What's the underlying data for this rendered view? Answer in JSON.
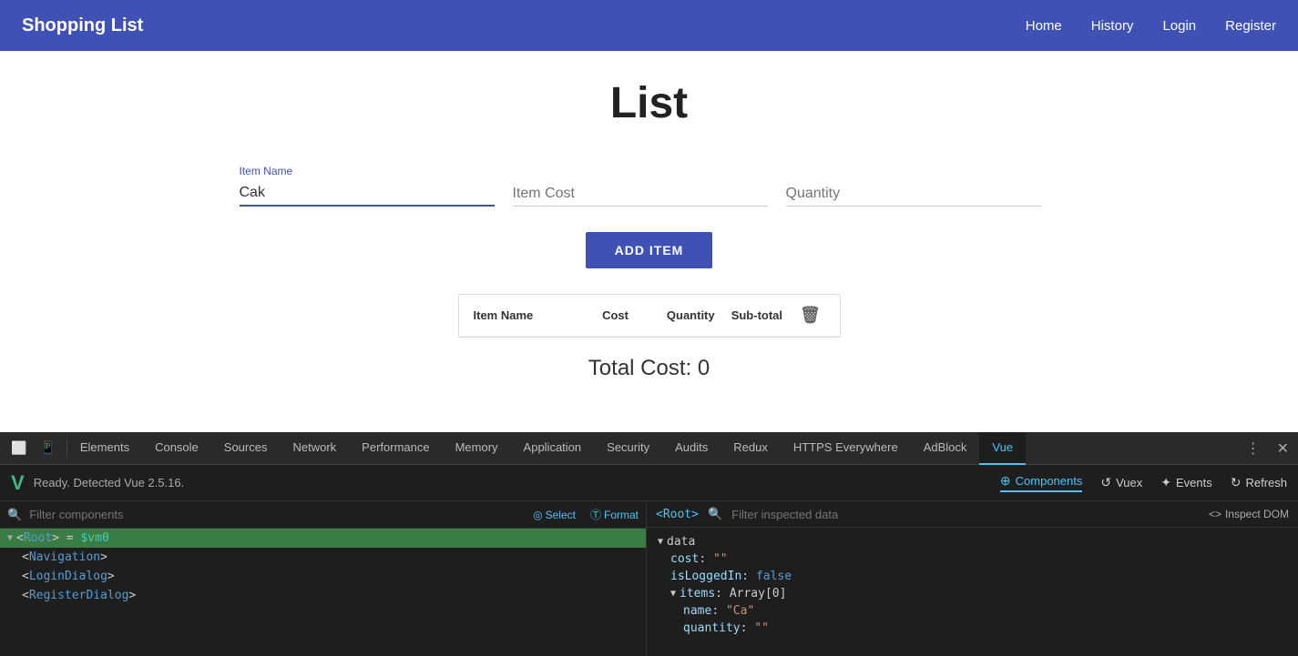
{
  "topNav": {
    "brand": "Shopping List",
    "links": [
      "Home",
      "History",
      "Login",
      "Register"
    ]
  },
  "main": {
    "heading": "List",
    "form": {
      "itemNameLabel": "Item Name",
      "itemNameValue": "Cak",
      "itemCostPlaceholder": "Item Cost",
      "quantityPlaceholder": "Quantity",
      "addButtonLabel": "ADD ITEM"
    },
    "table": {
      "headers": [
        "Item Name",
        "Cost",
        "Quantity",
        "Sub-total"
      ],
      "rows": []
    },
    "totalCost": "Total Cost: 0"
  },
  "devtools": {
    "tabs": [
      {
        "label": "Elements",
        "active": false
      },
      {
        "label": "Console",
        "active": false
      },
      {
        "label": "Sources",
        "active": false
      },
      {
        "label": "Network",
        "active": false
      },
      {
        "label": "Performance",
        "active": false
      },
      {
        "label": "Memory",
        "active": false
      },
      {
        "label": "Application",
        "active": false
      },
      {
        "label": "Security",
        "active": false
      },
      {
        "label": "Audits",
        "active": false
      },
      {
        "label": "Redux",
        "active": false
      },
      {
        "label": "HTTPS Everywhere",
        "active": false
      },
      {
        "label": "AdBlock",
        "active": false
      },
      {
        "label": "Vue",
        "active": true
      }
    ],
    "vue": {
      "status": "Ready. Detected Vue 2.5.16.",
      "actions": [
        {
          "label": "Components",
          "icon": "⊕",
          "active": true
        },
        {
          "label": "Vuex",
          "icon": "↺"
        },
        {
          "label": "Events",
          "icon": "✦"
        },
        {
          "label": "Refresh",
          "icon": "↻"
        }
      ],
      "filterPlaceholder": "Filter components",
      "selectLabel": "Select",
      "formatLabel": "Format",
      "tree": [
        {
          "level": 0,
          "content": "<Root> = $vm0",
          "selected": true,
          "triangle": "▼"
        },
        {
          "level": 1,
          "content": "<Navigation>",
          "selected": false,
          "triangle": ""
        },
        {
          "level": 1,
          "content": "<LoginDialog>",
          "selected": false,
          "triangle": ""
        },
        {
          "level": 1,
          "content": "<RegisterDialog>",
          "selected": false,
          "triangle": ""
        }
      ],
      "rightPanel": {
        "rootTag": "<Root>",
        "filterPlaceholder": "Filter inspected data",
        "inspectDomLabel": "Inspect DOM",
        "dataLabel": "data",
        "fields": [
          {
            "key": "cost",
            "value": "\"\"",
            "type": "str"
          },
          {
            "key": "isLoggedIn",
            "value": "false",
            "type": "bool"
          },
          {
            "key": "items",
            "value": "Array[0]",
            "type": "arr",
            "expanded": true
          },
          {
            "key": "name",
            "value": "\"Ca\"",
            "type": "str",
            "indent": 2
          },
          {
            "key": "quantity",
            "value": "\"\"",
            "type": "str",
            "indent": 2
          }
        ]
      }
    }
  }
}
